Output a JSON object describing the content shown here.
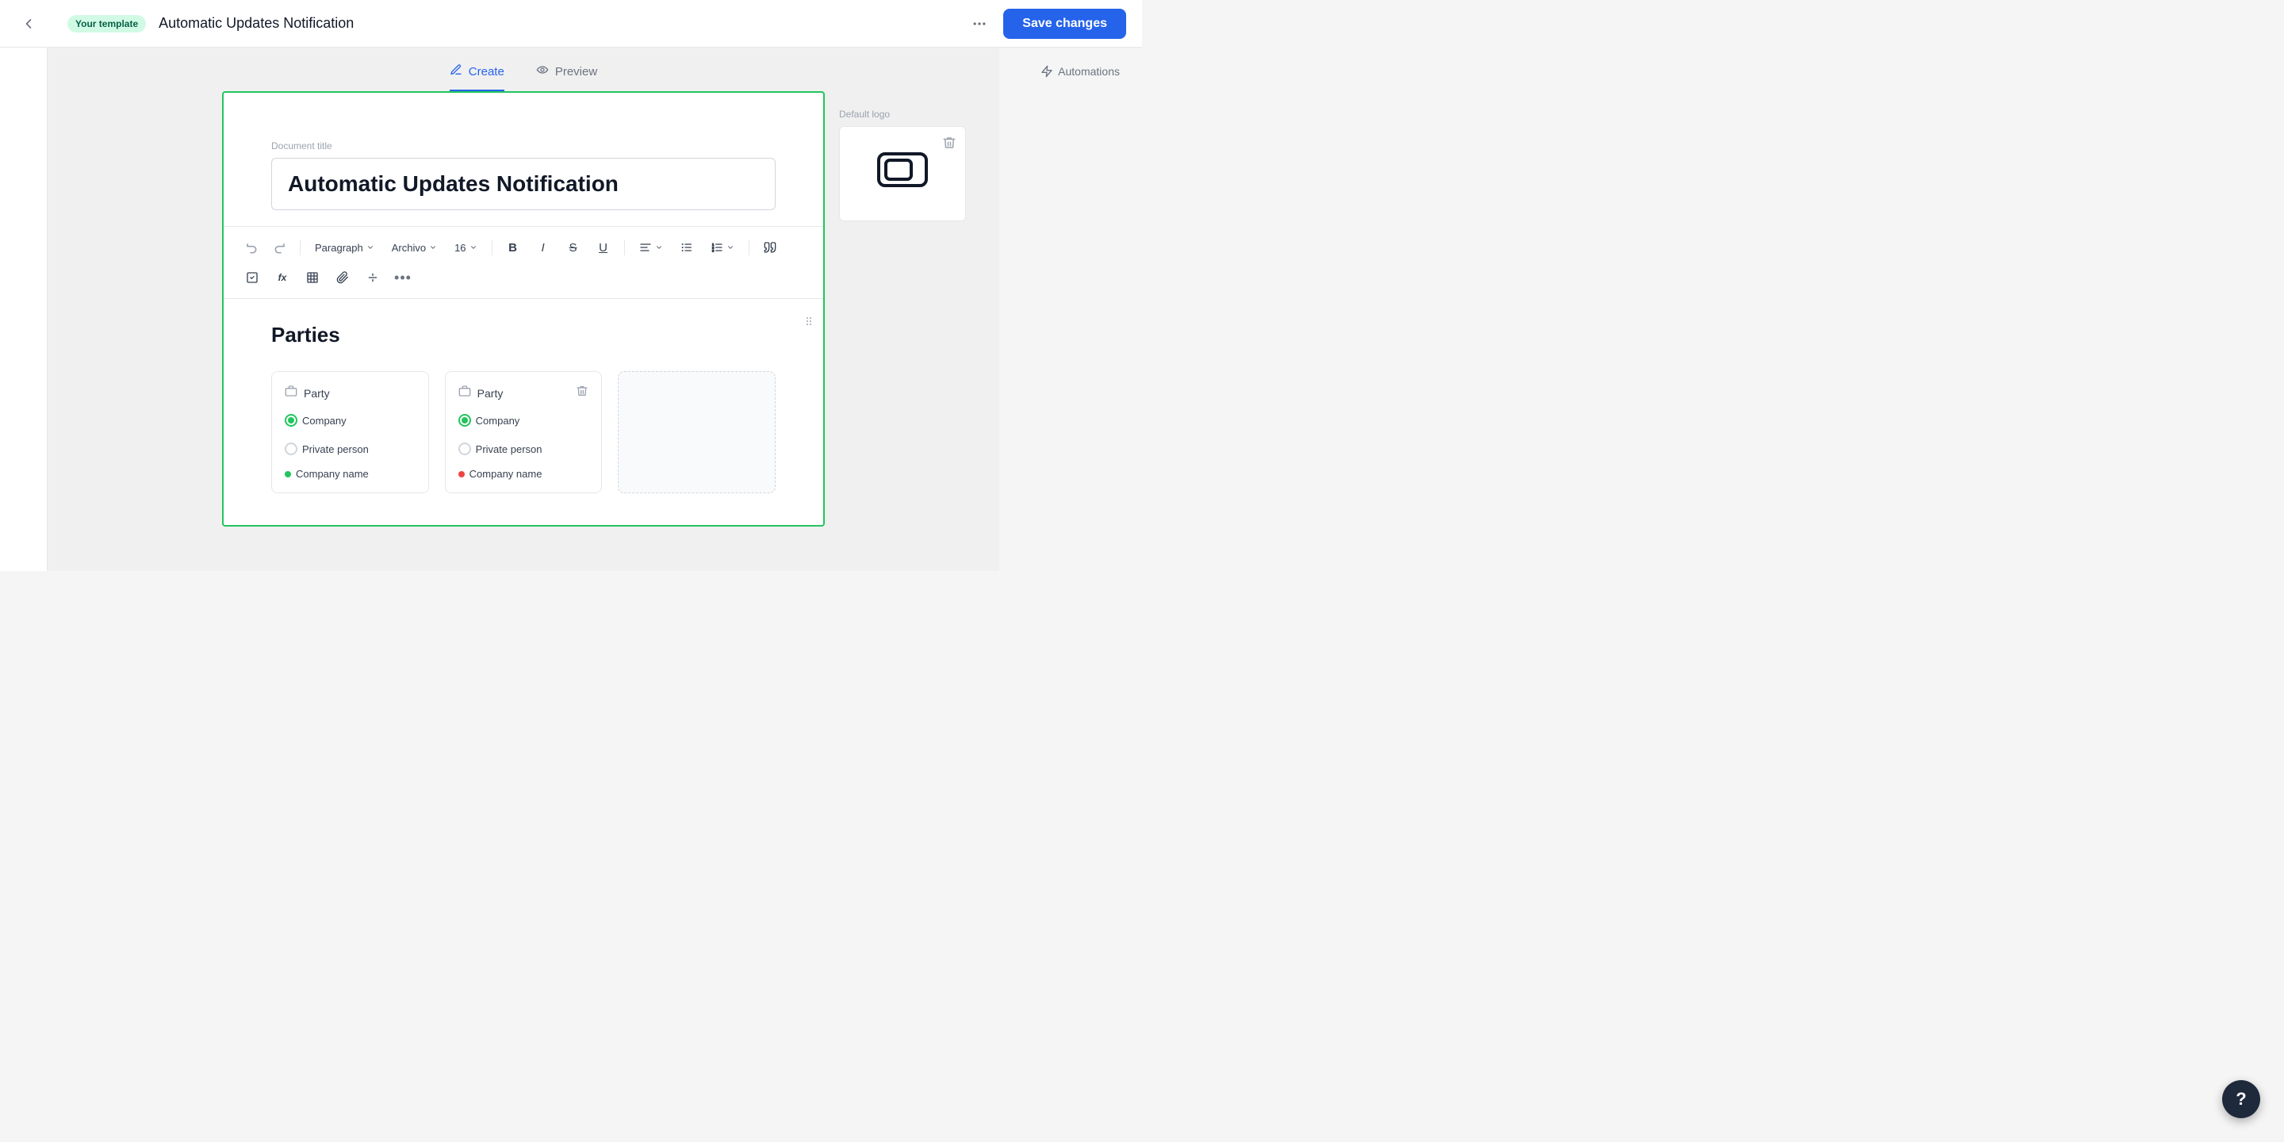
{
  "header": {
    "template_badge": "Your template",
    "doc_title": "Automatic Updates Notification",
    "more_icon": "•••",
    "save_label": "Save changes"
  },
  "tabs": [
    {
      "id": "create",
      "label": "Create",
      "active": true
    },
    {
      "id": "preview",
      "label": "Preview",
      "active": false
    }
  ],
  "automations": {
    "label": "Automations"
  },
  "logo": {
    "label": "Default logo",
    "delete_tooltip": "Delete logo"
  },
  "document": {
    "title_label": "Document title",
    "title_value": "Automatic Updates Notification"
  },
  "toolbar": {
    "undo_label": "↩",
    "redo_label": "↪",
    "paragraph_label": "Paragraph",
    "font_label": "Archivo",
    "size_label": "16",
    "bold_label": "B",
    "italic_label": "I",
    "strike_label": "S",
    "underline_label": "U",
    "align_label": "≡",
    "bullet_label": "≡",
    "numbered_label": "≡",
    "quote_label": "❝",
    "checkbox_label": "☑",
    "formula_label": "fx",
    "table_label": "⊞",
    "attach_label": "🔗",
    "hr_label": "—",
    "more_label": "•••"
  },
  "sections": {
    "parties_title": "Parties",
    "party1": {
      "label": "Party",
      "type": "company",
      "company_option": "Company",
      "private_option": "Private person",
      "field_label": "Company name",
      "dot_color": "green"
    },
    "party2": {
      "label": "Party",
      "type": "company",
      "company_option": "Company",
      "private_option": "Private person",
      "field_label": "Company name",
      "dot_color": "red"
    }
  },
  "help": {
    "label": "?"
  }
}
